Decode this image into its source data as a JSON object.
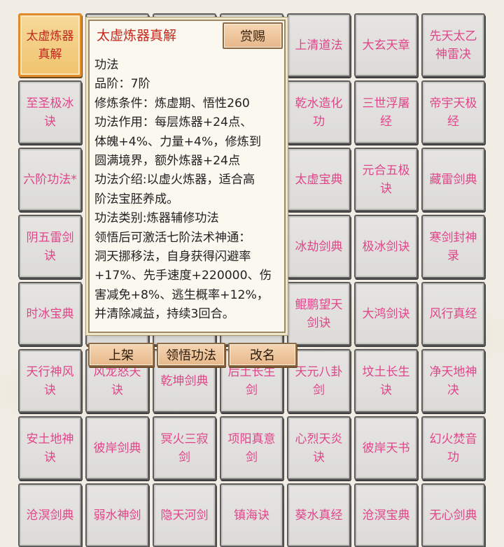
{
  "grid": [
    "太虚炼器真解",
    "",
    "",
    "",
    "上清道法",
    "大玄天章",
    "先天太乙神雷决",
    "至圣极冰诀",
    "",
    "",
    "",
    "乾水造化功",
    "三世浮屠经",
    "帝宇天极经",
    "六阶功法*",
    "",
    "",
    "",
    "太虚宝典",
    "元合五极诀",
    "藏雷剑典",
    "阴五雷剑诀",
    "",
    "",
    "",
    "冰劫剑典",
    "极冰剑诀",
    "寒剑封神录",
    "时冰宝典",
    "",
    "",
    "",
    "鲲鹏望天剑诀",
    "大鸿剑诀",
    "风行真经",
    "天行神风诀",
    "风龙怒天诀",
    "乾坤剑典",
    "后土长生剑",
    "天元八卦剑",
    "坟土长生诀",
    "净天地神决",
    "安土地神诀",
    "彼岸剑典",
    "冥火三寂剑",
    "项阳真意剑",
    "心烈天炎诀",
    "彼岸天书",
    "幻火焚音功",
    "沧溟剑典",
    "弱水神剑",
    "隐天河剑",
    "镇海诀",
    "葵水真经",
    "沧溟宝典",
    "无心剑典"
  ],
  "selected_index": 0,
  "popup": {
    "title": "太虚炼器真解",
    "reward_label": "赏赐",
    "lines": [
      "功法",
      "品阶：7阶",
      "修炼条件：炼虚期、悟性260",
      "功法作用：每层炼器+24点、",
      "体魄+4%、力量+4%，修炼到",
      "圆满境界，额外炼器+24点",
      "功法介绍:以虚火炼器，适合高",
      "阶法宝胚养成。",
      "功法类别:炼器辅修功法",
      "领悟后可激活七阶法术神通：",
      "洞天挪移法，自身获得闪避率",
      "+17%、先手速度+220000、伤",
      "害减免+8%、逃生概率+12%，",
      "并清除减益，持续3回合。"
    ]
  },
  "actions": {
    "shelve": "上架",
    "comprehend": "领悟功法",
    "rename": "改名"
  },
  "colors": {
    "item_text": "#e0458a",
    "selected_text": "#c0281e",
    "selected_bg": "#efc46e"
  }
}
